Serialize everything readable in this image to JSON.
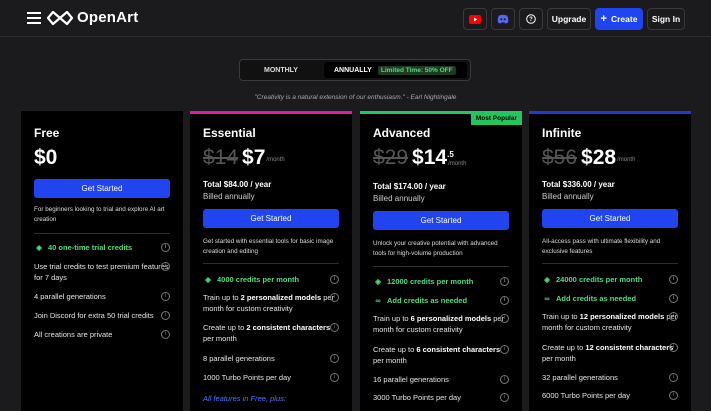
{
  "header": {
    "logo_text": "OpenArt",
    "upgrade_label": "Upgrade",
    "create_label": "Create",
    "signin_label": "Sign In",
    "youtube_color": "#ff0000",
    "discord_color": "#5865f2",
    "accent_color": "#1f44f0"
  },
  "billing_toggle": {
    "monthly_label": "MONTHLY",
    "annually_label": "ANNUALLY",
    "promo_badge": "Limited Time: 50% OFF"
  },
  "quote": "\"Creativity is a natural extension of our enthusiasm.\" - Earl Nightingale",
  "plans": [
    {
      "name": "Free",
      "price": "$0",
      "cta": "Get Started",
      "description": "For beginners looking to trial and explore AI art creation",
      "credits": "40 one-time trial credits",
      "features": [
        "Use trial credits to test premium features for 7 days",
        "4 parallel generations",
        "Join Discord for extra 50 trial credits",
        "All creations are private"
      ]
    },
    {
      "name": "Essential",
      "old_price": "$14",
      "price": "$7",
      "per": "/month",
      "yearly": "Total $84.00 / year",
      "billed": "Billed annually",
      "cta": "Get Started",
      "description": "Get started with essential tools for basic image creation and editing",
      "credits": "4000 credits per month",
      "features": [
        {
          "pre": "Train up to ",
          "bold": "2 personalized models",
          "post": " per month for custom creativity"
        },
        {
          "pre": "Create up to ",
          "bold": "2 consistent characters",
          "post": " per month"
        },
        {
          "pre": "8 parallel generations"
        },
        {
          "pre": "1000 Turbo Points per day"
        }
      ],
      "link": "All features in Free, plus:"
    },
    {
      "name": "Advanced",
      "badge": "Most Popular",
      "old_price": "$29",
      "price": "$14",
      "price_sup": ".5",
      "per": "/month",
      "yearly": "Total $174.00 / year",
      "billed": "Billed annually",
      "cta": "Get Started",
      "description": "Unlock your creative potential with advanced tools for high-volume production",
      "credits": "12000 credits per month",
      "add_credits": "Add credits as needed",
      "features": [
        {
          "pre": "Train up to ",
          "bold": "6 personalized models",
          "post": " per month for custom creativity"
        },
        {
          "pre": "Create up to ",
          "bold": "6 consistent characters",
          "post": " per month"
        },
        {
          "pre": "16 parallel generations"
        },
        {
          "pre": "3000 Turbo Points per day"
        }
      ]
    },
    {
      "name": "Infinite",
      "old_price": "$56",
      "price": "$28",
      "per": "/month",
      "yearly": "Total $336.00 / year",
      "billed": "Billed annually",
      "cta": "Get Started",
      "description": "All-access pass with ultimate flexibility and exclusive features",
      "credits": "24000 credits per month",
      "add_credits": "Add credits as needed",
      "features": [
        {
          "pre": "Train up to ",
          "bold": "12 personalized models",
          "post": " per month for custom creativity"
        },
        {
          "pre": "Create up to ",
          "bold": "12 consistent characters",
          "post": " per month"
        },
        {
          "pre": "32 parallel generations"
        },
        {
          "pre": "6000 Turbo Points per day"
        }
      ]
    }
  ],
  "plan_colors": {
    "essential": "#e11d9b",
    "advanced": "#22c55e",
    "infinite": "#1f3bd6",
    "credits_green": "#4ade80"
  }
}
